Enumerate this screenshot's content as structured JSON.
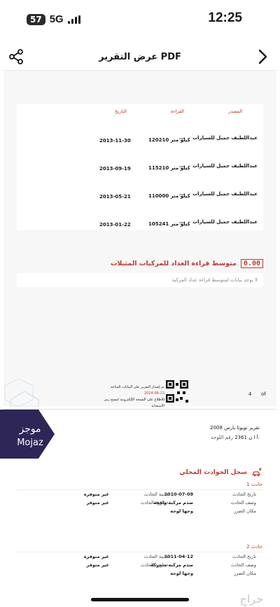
{
  "status_bar": {
    "battery": "57",
    "network": "5G",
    "time": "12:25"
  },
  "nav": {
    "title": "عرض التقرير PDF"
  },
  "mileage_table": {
    "headers": {
      "source": "المصدر",
      "reading": "القراءة",
      "date": "التاريخ"
    },
    "rows": [
      {
        "source": "عبداللطيف جميل للسيارات",
        "reading": "120210 كيلو متر",
        "date": "2013-11-30"
      },
      {
        "source": "عبداللطيف جميل للسيارات",
        "reading": "115210 كيلو متر",
        "date": "2013-09-19"
      },
      {
        "source": "عبداللطيف جميل للسيارات",
        "reading": "110000 كيلو متر",
        "date": "2013-05-21"
      },
      {
        "source": "عبداللطيف جميل للسيارات",
        "reading": "105241 كيلو متر",
        "date": "2013-01-22"
      }
    ]
  },
  "average_section": {
    "badge": "0.00",
    "title": "متوسط قراءة العداد للمركبات المثيلات",
    "empty_text": "لا يوجد بيانات لمتوسط قراءة عداد المركبة"
  },
  "page1_footer": {
    "page_number": "4",
    "of_label": "of",
    "note_line1": "تم إصدار التقرير على البيانات المتاحة",
    "note_date": "2024-06-13",
    "note_line2": "للاطلاع على النسخة الإلكترونية امسح رمز الاستجابة"
  },
  "page2": {
    "logo_ar": "موجز",
    "logo_en": "Mojaz",
    "car_model": "تقرير تويوتا يارس 2008",
    "plate_label": "رقم اللوحة:",
    "plate_value": "أ ا ن 2361",
    "accidents_title": "سجل الحوادث المحلي",
    "accidents": [
      {
        "label": "حادث 1",
        "rows": [
          {
            "k1": "تاريخ الحادث",
            "v1": "2010-07-09",
            "k2": "مدينة الحادث",
            "v2": "غير متوفرة"
          },
          {
            "k1": "وصف الحادث",
            "v1": "صدم مركبة واقفة",
            "k2": "خطورة الحادث",
            "v2": "غير متوفر"
          },
          {
            "k1": "مكان الضرر",
            "v1": "وجها لوجه",
            "k2": "",
            "v2": ""
          }
        ]
      },
      {
        "label": "حادث 2",
        "rows": [
          {
            "k1": "تاريخ الحادث",
            "v1": "2011-04-12",
            "k2": "مدينة الحادث",
            "v2": "غير متوفرة"
          },
          {
            "k1": "وصف الحادث",
            "v1": "صدم مركبة متحركة",
            "k2": "خطورة الحادث",
            "v2": "غير متوفر"
          },
          {
            "k1": "مكان الضرر",
            "v1": "وجها لوجه",
            "k2": "",
            "v2": ""
          }
        ]
      }
    ]
  },
  "watermark": "حراج"
}
